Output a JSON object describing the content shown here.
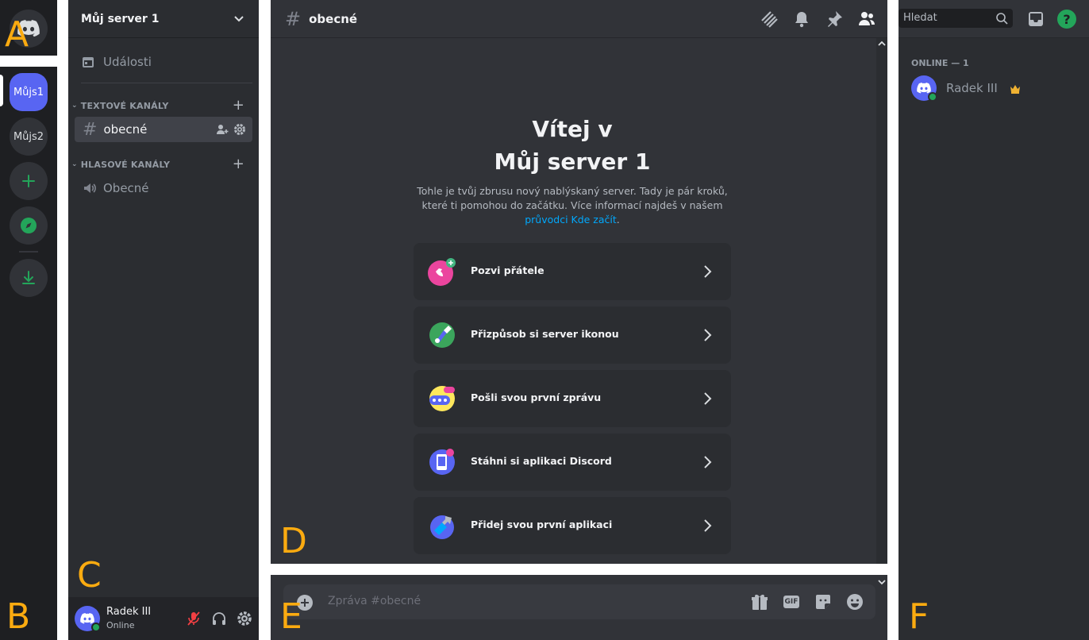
{
  "panel_letters": {
    "a": "A",
    "b": "B",
    "c": "C",
    "d": "D",
    "e": "E",
    "f": "F"
  },
  "servers": [
    {
      "label": "Můjs1",
      "active": true
    },
    {
      "label": "Můjs2",
      "active": false
    }
  ],
  "channels_panel": {
    "server_name": "Můj server 1",
    "events_label": "Události",
    "text_category": "TEXTOVÉ KANÁLY",
    "text_channels": [
      {
        "name": "obecné",
        "selected": true
      }
    ],
    "voice_category": "HLASOVÉ KANÁLY",
    "voice_channels": [
      {
        "name": "Obecné"
      }
    ]
  },
  "user_panel": {
    "username": "Radek III",
    "status": "Online"
  },
  "chat": {
    "channel_name": "obecné",
    "welcome_line1": "Vítej v",
    "welcome_line2": "Můj server 1",
    "desc_part1": "Tohle je tvůj zbrusu nový nablýskaný server. Tady je pár kroků, které ti pomohou do začátku. Více informací najdeš v našem ",
    "desc_link": "průvodci Kde začít",
    "desc_end": ".",
    "cards": [
      {
        "label": "Pozvi přátele",
        "icon": "invite-friends-icon",
        "color": "#eb459e"
      },
      {
        "label": "Přizpůsob si server ikonou",
        "icon": "customize-icon",
        "color": "#3ba55c"
      },
      {
        "label": "Pošli svou první zprávu",
        "icon": "first-message-icon",
        "color": "#fee75c"
      },
      {
        "label": "Stáhni si aplikaci Discord",
        "icon": "download-app-icon",
        "color": "#5865f2"
      },
      {
        "label": "Přidej svou první aplikaci",
        "icon": "add-app-icon",
        "color": "#5865f2"
      }
    ]
  },
  "composer": {
    "placeholder": "Zpráva #obecné",
    "gif_label": "GIF"
  },
  "members_panel": {
    "search_placeholder": "Hledat",
    "help_label": "?",
    "online_header": "ONLINE — 1",
    "members": [
      {
        "name": "Radek III",
        "owner": true
      }
    ]
  },
  "colors": {
    "brand": "#5865f2",
    "online": "#23a55a",
    "link": "#00a8fc",
    "label_overlay": "#fbab10",
    "danger": "#f23f43"
  }
}
